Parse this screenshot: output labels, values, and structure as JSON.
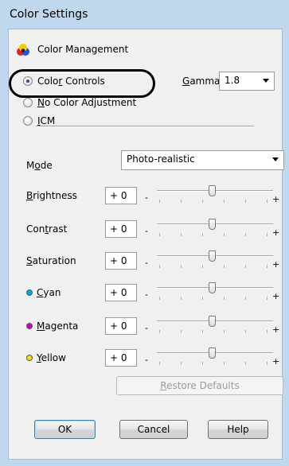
{
  "window": {
    "title": "Color Settings"
  },
  "color_management": {
    "label": "Color Management"
  },
  "radios": [
    {
      "label": "Color Controls",
      "checked": true
    },
    {
      "label": "No Color Adjustment",
      "checked": false
    },
    {
      "label": "ICM",
      "checked": false
    }
  ],
  "gamma": {
    "label": "Gamma",
    "value": "1.8"
  },
  "mode": {
    "label": "Mode",
    "value": "Photo-realistic"
  },
  "sliders": [
    {
      "label": "Brightness",
      "value": "+ 0",
      "dot_color": null
    },
    {
      "label": "Contrast",
      "value": "+ 0",
      "dot_color": null
    },
    {
      "label": "Saturation",
      "value": "+ 0",
      "dot_color": null
    },
    {
      "label": "Cyan",
      "value": "+ 0",
      "dot_color": "#00aaee"
    },
    {
      "label": "Magenta",
      "value": "+ 0",
      "dot_color": "#cc00cc"
    },
    {
      "label": "Yellow",
      "value": "+ 0",
      "dot_color": "#f2e000"
    }
  ],
  "slider_minus": "-",
  "slider_plus": "+",
  "restore_defaults": "Restore Defaults",
  "buttons": {
    "ok": "OK",
    "cancel": "Cancel",
    "help": "Help"
  }
}
